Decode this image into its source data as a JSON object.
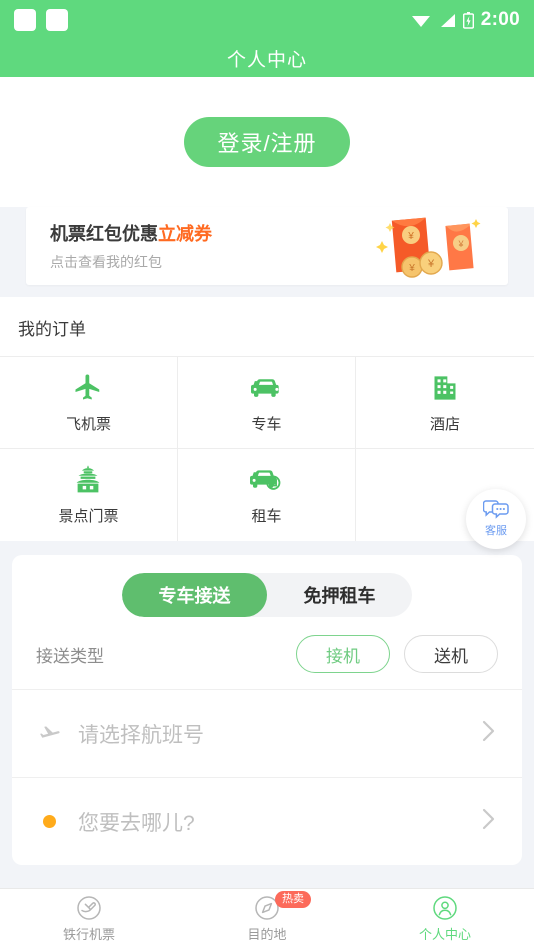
{
  "status_bar": {
    "time": "2:00",
    "icons": [
      "notification-square",
      "notification-square",
      "wifi-icon",
      "signal-icon",
      "battery-icon"
    ]
  },
  "header": {
    "title": "个人中心"
  },
  "login": {
    "button_label": "登录/注册"
  },
  "coupon": {
    "title_main": "机票红包优惠",
    "title_highlight": "立减券",
    "subtitle": "点击查看我的红包",
    "highlight_color": "#FF6A21",
    "currency_symbol": "¥"
  },
  "orders": {
    "section_title": "我的订单",
    "items": [
      {
        "label": "飞机票",
        "icon": "plane-icon"
      },
      {
        "label": "专车",
        "icon": "car-icon"
      },
      {
        "label": "酒店",
        "icon": "hotel-icon"
      },
      {
        "label": "景点门票",
        "icon": "pagoda-icon"
      },
      {
        "label": "租车",
        "icon": "rental-car-icon"
      },
      {
        "label": "",
        "icon": ""
      }
    ]
  },
  "customer_service": {
    "label": "客服",
    "icon": "chat-bubble-icon",
    "color": "#6B9BF0"
  },
  "booking": {
    "tabs": [
      {
        "label": "专车接送",
        "active": true
      },
      {
        "label": "免押租车",
        "active": false
      }
    ],
    "type_row": {
      "label": "接送类型",
      "options": [
        {
          "label": "接机",
          "selected": true
        },
        {
          "label": "送机",
          "selected": false
        }
      ]
    },
    "fields": [
      {
        "placeholder": "请选择航班号",
        "icon": "plane-takeoff-icon"
      },
      {
        "placeholder": "您要去哪儿?",
        "icon": "location-dot-icon"
      }
    ]
  },
  "tabbar": {
    "items": [
      {
        "label": "铁行机票",
        "icon": "plane-circle-icon",
        "active": false,
        "badge": ""
      },
      {
        "label": "目的地",
        "icon": "compass-icon",
        "active": false,
        "badge": "热卖"
      },
      {
        "label": "个人中心",
        "icon": "person-circle-icon",
        "active": true,
        "badge": ""
      }
    ]
  },
  "theme": {
    "green": "#5FD97E",
    "button_green": "#66D37B",
    "tab_green": "#5FBE6E",
    "orange": "#FF6A21",
    "badge_red": "#FC6A5A",
    "page_bg": "#F2F4F8"
  }
}
